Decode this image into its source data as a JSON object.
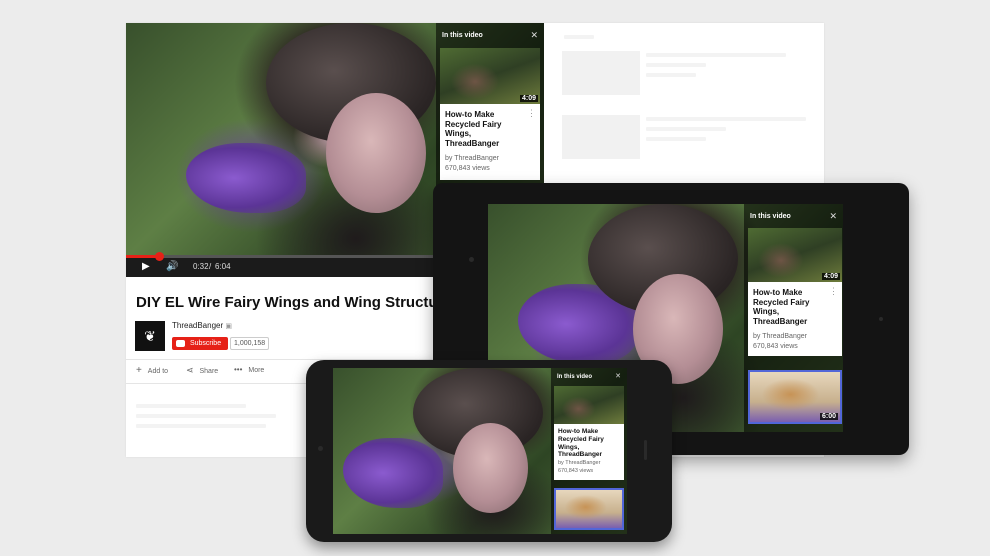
{
  "desktop": {
    "video": {
      "current_time": "0:32",
      "duration": "6:04",
      "progress": 0.08,
      "panel": {
        "header": "In this video",
        "card": {
          "duration": "4:09",
          "title": "How-to Make Recycled Fairy Wings, ThreadBanger",
          "by": "by ThreadBanger",
          "views": "670,843 views"
        }
      }
    },
    "title": "DIY EL Wire Fairy Wings and Wing Structure Tutorial",
    "channel": "ThreadBanger",
    "subscribe_label": "Subscribe",
    "subscriber_count": "1,000,158",
    "actions": {
      "add": "Add to",
      "share": "Share",
      "more": "More"
    }
  },
  "tablet": {
    "panel": {
      "header": "In this video",
      "card1": {
        "duration": "4:09",
        "title": "How-to Make Recycled Fairy Wings, ThreadBanger",
        "by": "by ThreadBanger",
        "views": "670,843 views"
      },
      "card2": {
        "duration": "6:00"
      }
    }
  },
  "phone": {
    "panel": {
      "header": "In this video",
      "card1": {
        "title": "How-to Make Recycled Fairy Wings, ThreadBanger",
        "by": "by ThreadBanger",
        "views": "670,843 views"
      }
    }
  },
  "colors": {
    "accent": "#e62117",
    "card_border": "#5266d8"
  }
}
